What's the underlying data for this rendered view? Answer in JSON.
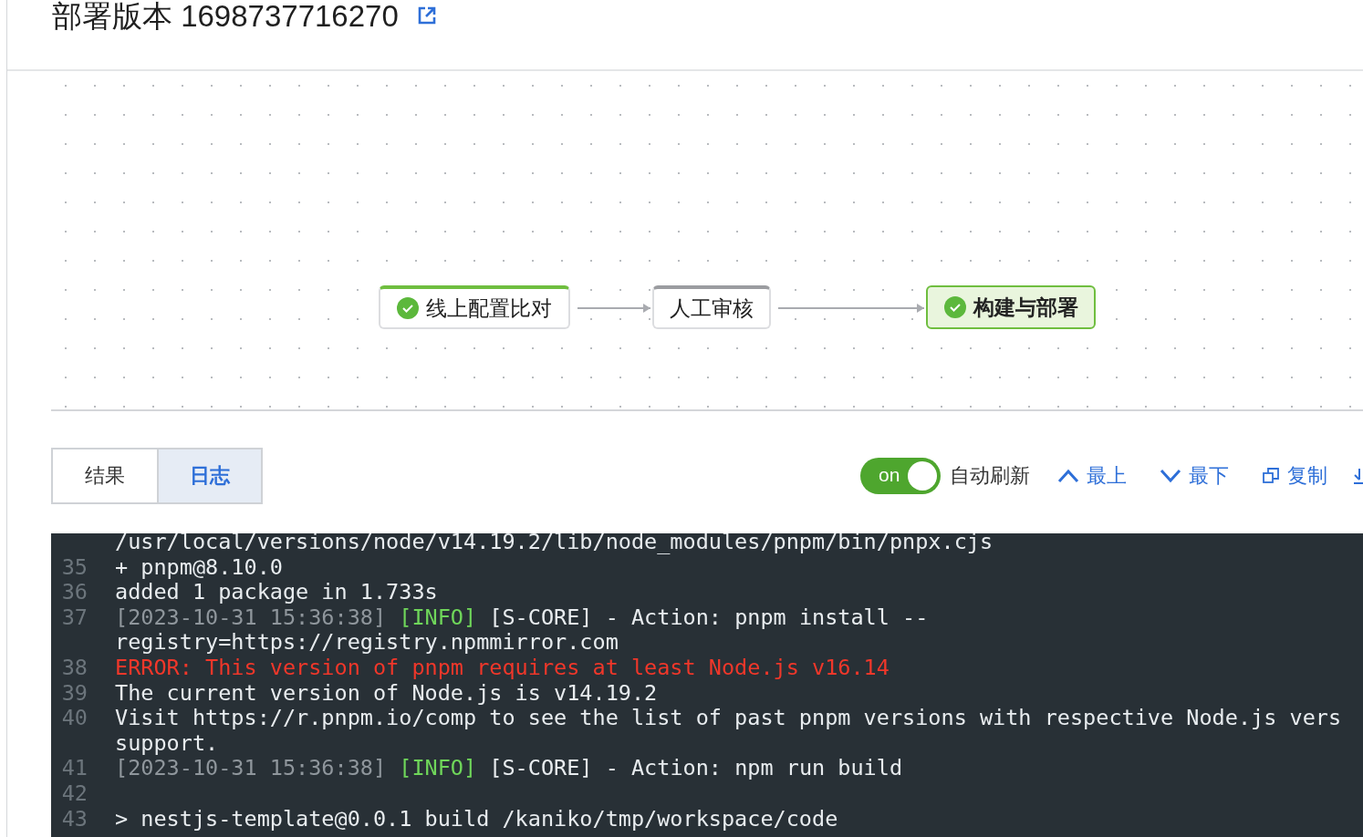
{
  "title": "部署版本 1698737716270",
  "pipeline": [
    {
      "label": "线上配置比对",
      "completed": true,
      "selected": false
    },
    {
      "label": "人工审核",
      "completed": false,
      "selected": false
    },
    {
      "label": "构建与部署",
      "completed": true,
      "selected": true
    }
  ],
  "tabs": [
    {
      "label": "结果",
      "selected": false
    },
    {
      "label": "日志",
      "selected": true
    }
  ],
  "auto_refresh": {
    "on": true,
    "switch_text": "on",
    "label": "自动刷新"
  },
  "actions": [
    {
      "kind": "top",
      "label": "最上"
    },
    {
      "kind": "bottom",
      "label": "最下"
    },
    {
      "kind": "copy",
      "label": "复制"
    },
    {
      "kind": "download"
    }
  ],
  "log": [
    {
      "rows": [
        [
          {
            "kind": "text",
            "text": "/usr/local/versions/node/v14.19.2/lib/node_modules/pnpm/bin/pnpx.cjs"
          }
        ]
      ]
    },
    {
      "number": "35",
      "rows": [
        [
          {
            "kind": "text",
            "text": "+ pnpm@8.10.0"
          }
        ]
      ]
    },
    {
      "number": "36",
      "rows": [
        [
          {
            "kind": "text",
            "text": "added 1 package in 1.733s"
          }
        ]
      ]
    },
    {
      "number": "37",
      "rows": [
        [
          {
            "kind": "time",
            "text": "[2023-10-31 15:36:38]"
          },
          {
            "kind": "info",
            "text": " [INFO]"
          },
          {
            "kind": "text",
            "text": " [S-CORE] - Action: pnpm install --"
          }
        ],
        [
          {
            "kind": "text",
            "text": "registry=https://registry.npmmirror.com"
          }
        ]
      ]
    },
    {
      "number": "38",
      "rows": [
        [
          {
            "kind": "error",
            "text": "ERROR: This version of pnpm requires at least Node.js v16.14"
          }
        ]
      ]
    },
    {
      "number": "39",
      "rows": [
        [
          {
            "kind": "text",
            "text": "The current version of Node.js is v14.19.2"
          }
        ]
      ]
    },
    {
      "number": "40",
      "rows": [
        [
          {
            "kind": "text",
            "text": "Visit https://r.pnpm.io/comp to see the list of past pnpm versions with respective Node.js vers"
          }
        ],
        [
          {
            "kind": "text",
            "text": "support."
          }
        ]
      ]
    },
    {
      "number": "41",
      "rows": [
        [
          {
            "kind": "time",
            "text": "[2023-10-31 15:36:38]"
          },
          {
            "kind": "info",
            "text": " [INFO]"
          },
          {
            "kind": "text",
            "text": " [S-CORE] - Action: npm run build"
          }
        ]
      ]
    },
    {
      "number": "42",
      "rows": [
        []
      ]
    },
    {
      "number": "43",
      "rows": [
        [
          {
            "kind": "text",
            "text": "> nestjs-template@0.0.1 build /kaniko/tmp/workspace/code"
          }
        ]
      ]
    }
  ]
}
